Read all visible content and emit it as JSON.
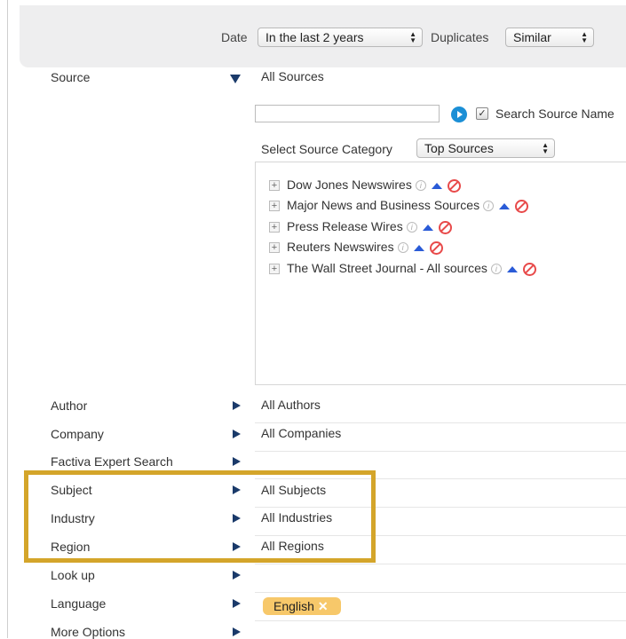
{
  "toolbar": {
    "date_label": "Date",
    "date_value": "In the last 2 years",
    "duplicates_label": "Duplicates",
    "duplicates_value": "Similar"
  },
  "source": {
    "label": "Source",
    "value": "All Sources",
    "search_input_value": "",
    "search_source_names_label": "Search Source Name",
    "category_label": "Select Source Category",
    "category_value": "Top Sources",
    "items": [
      "Dow Jones Newswires",
      "Major News and Business Sources",
      "Press Release Wires",
      "Reuters Newswires",
      "The Wall Street Journal - All sources"
    ]
  },
  "rows": {
    "author": {
      "label": "Author",
      "value": "All Authors"
    },
    "company": {
      "label": "Company",
      "value": "All Companies"
    },
    "expert": {
      "label": "Factiva Expert Search",
      "value": ""
    },
    "subject": {
      "label": "Subject",
      "value": "All Subjects"
    },
    "industry": {
      "label": "Industry",
      "value": "All Industries"
    },
    "region": {
      "label": "Region",
      "value": "All Regions"
    },
    "lookup": {
      "label": "Look up",
      "value": ""
    },
    "language": {
      "label": "Language",
      "tag": "English"
    },
    "more": {
      "label": "More Options",
      "value": ""
    }
  },
  "colors": {
    "highlight": "#d4a52a",
    "tag": "#f7c86a",
    "arrow": "#1a3a6a",
    "up_arrow": "#2a5bd7",
    "block": "#e84a4a"
  },
  "icons": {
    "expand": "triangle-right-icon",
    "collapse": "triangle-down-icon",
    "info": "info-icon",
    "up": "up-arrow-icon",
    "block": "block-icon",
    "go": "go-arrow-icon",
    "remove": "close-icon"
  }
}
